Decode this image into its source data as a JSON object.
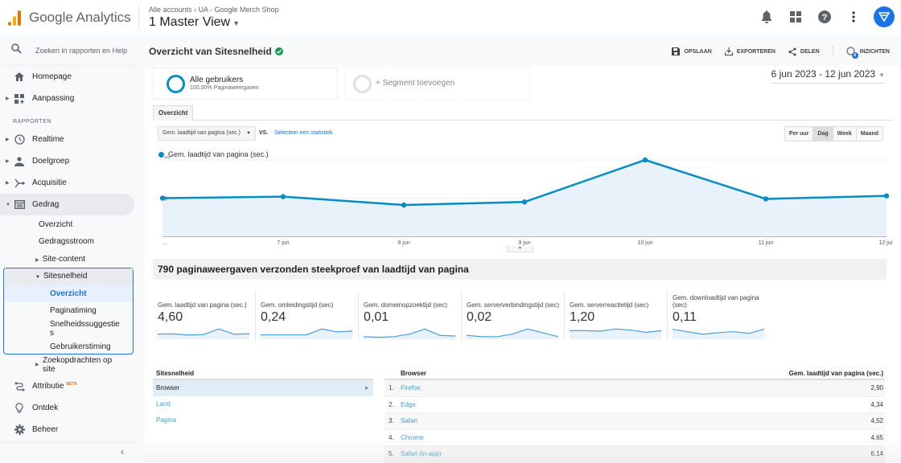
{
  "app": {
    "name": "Google Analytics",
    "brand_colors": {
      "bar1": "#f9ab00",
      "bar2": "#e37400",
      "accent": "#1a73e8"
    }
  },
  "header": {
    "breadcrumb": "Alle accounts › UA - Google Merch Shop",
    "view": "1 Master View"
  },
  "top_icons": [
    "bell-icon",
    "apps-grid-icon",
    "help-icon",
    "more-vert-icon",
    "account-avatar"
  ],
  "sidebar": {
    "search_placeholder": "Zoeken in rapporten en Help",
    "items_top": [
      {
        "label": "Homepage",
        "icon": "home-icon"
      },
      {
        "label": "Aanpassing",
        "icon": "dashboard-icon"
      }
    ],
    "section_label": "RAPPORTEN",
    "reports": [
      {
        "label": "Realtime",
        "icon": "clock-icon"
      },
      {
        "label": "Doelgroep",
        "icon": "person-icon"
      },
      {
        "label": "Acquisitie",
        "icon": "acquisition-icon"
      },
      {
        "label": "Gedrag",
        "icon": "behavior-icon"
      }
    ],
    "gedrag_sub": [
      "Overzicht",
      "Gedragsstroom",
      "Site-content",
      "Sitesnelheid"
    ],
    "sitesnelheid_sub": [
      "Overzicht",
      "Paginatiming",
      "Snelheidssuggestie\ns",
      "Gebruikerstiming"
    ],
    "zoek": "Zoekopdrachten op site",
    "bottom": [
      {
        "label": "Attributie",
        "badge": "BÈTA",
        "icon": "attribution-icon"
      },
      {
        "label": "Ontdek",
        "icon": "lightbulb-icon"
      },
      {
        "label": "Beheer",
        "icon": "gear-icon"
      }
    ]
  },
  "page": {
    "title": "Overzicht van Sitesnelheid",
    "actions": [
      "OPSLAAN",
      "EXPORTEREN",
      "DELEN",
      "INZICHTEN"
    ],
    "insights_badge": "8",
    "segment": {
      "name": "Alle gebruikers",
      "sub": "100,00% Paginaweergaven",
      "add": "+ Segment toevoegen"
    },
    "date_range": "6 jun 2023 - 12 jun 2023",
    "tab": "Overzicht",
    "metric_select": "Gem. laadtijd van pagina (sec.)",
    "vs": "VS.",
    "select_stat": "Selecteer een statistiek",
    "periods": [
      "Per uur",
      "Dag",
      "Week",
      "Maand"
    ],
    "active_period": "Dag",
    "summary": "790 paginaweergaven verzonden steekproef van laadtijd van pagina"
  },
  "chart_data": {
    "type": "area",
    "legend": "Gem. laadtijd van pagina (sec.)",
    "x": [
      "...",
      "7 jun",
      "8 jun",
      "9 jun",
      "10 jun",
      "11 jun",
      "12 jun"
    ],
    "values": [
      5.0,
      5.2,
      4.1,
      4.5,
      10.0,
      4.9,
      5.3
    ],
    "y_ticks": [
      "10",
      "5"
    ],
    "ylim": [
      0,
      10
    ],
    "color": "#058dc7",
    "fill": "#e9f2fa"
  },
  "sparklines": [
    {
      "label": "Gem. laadtijd van pagina (sec.)",
      "value": "4,60",
      "series": [
        5.0,
        5.2,
        4.1,
        4.5,
        10.0,
        4.9,
        5.3
      ]
    },
    {
      "label": "Gem. omleidingstijd (sec)",
      "value": "0,24",
      "series": [
        3,
        3,
        3,
        3,
        7,
        5,
        5.5
      ]
    },
    {
      "label": "Gem. domeinopzoektijd (sec)",
      "value": "0,01",
      "series": [
        2,
        1.5,
        2,
        4,
        8,
        3,
        2.5
      ]
    },
    {
      "label": "Gem. serververbindingstijd (sec)",
      "value": "0,02",
      "series": [
        3,
        2,
        2,
        4,
        8,
        5,
        2
      ]
    },
    {
      "label": "Gem. serverreactietijd (sec)",
      "value": "1,20",
      "series": [
        5,
        5,
        4.7,
        6,
        5.4,
        4,
        5
      ]
    },
    {
      "label": "Gem. downloadtijd van pagina (sec)",
      "value": "0,11",
      "series": [
        6,
        4.5,
        3,
        4,
        4.6,
        3.5,
        6.2
      ]
    }
  ],
  "left_table": {
    "header": "Sitesnelheid",
    "rows": [
      "Browser",
      "Land",
      "Pagina"
    ],
    "selected": "Browser"
  },
  "right_table": {
    "headers": [
      "Browser",
      "Gem. laadtijd van pagina (sec.)"
    ],
    "rows": [
      {
        "idx": "1.",
        "name": "Firefox",
        "value": "2,90"
      },
      {
        "idx": "2.",
        "name": "Edge",
        "value": "4,34"
      },
      {
        "idx": "3.",
        "name": "Safari",
        "value": "4,52"
      },
      {
        "idx": "4.",
        "name": "Chrome",
        "value": "4,65"
      },
      {
        "idx": "5.",
        "name": "Safari (in-app)",
        "value": "6,14"
      }
    ]
  }
}
